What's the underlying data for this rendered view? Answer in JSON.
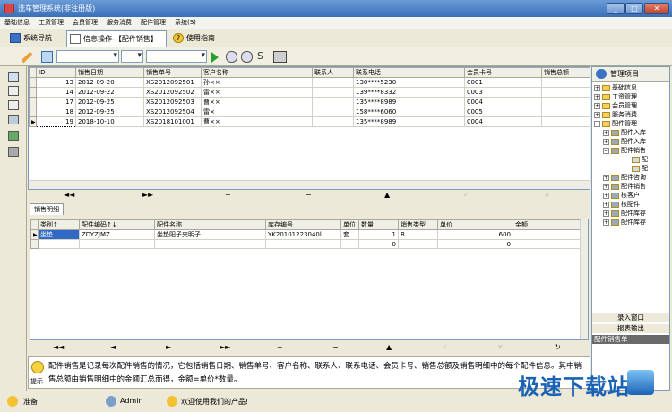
{
  "window": {
    "title": "洗车管理系统(非注册版)"
  },
  "menu": [
    "基础信息",
    "工资管理",
    "会员管理",
    "服务消费",
    "配件管理",
    "系统(S)"
  ],
  "tabs": [
    {
      "label": "系统导航"
    },
    {
      "label": "信息操作-【配件销售】"
    },
    {
      "label": "使用指南"
    }
  ],
  "sales_grid": {
    "columns": [
      "ID",
      "销售日期",
      "销售单号",
      "客户名称",
      "联系人",
      "联系电话",
      "会员卡号",
      "销售总额"
    ],
    "rows": [
      [
        "13",
        "2012-09-20",
        "XS2012092501",
        "孙××",
        "",
        "130****5230",
        "0001",
        ""
      ],
      [
        "14",
        "2012-09-22",
        "XS2012092502",
        "雷××",
        "",
        "139****8332",
        "0003",
        ""
      ],
      [
        "17",
        "2012-09-25",
        "XS2012092503",
        "曹××",
        "",
        "135****8989",
        "0004",
        ""
      ],
      [
        "18",
        "2012-09-25",
        "XS2012092504",
        "雷×",
        "",
        "158****6060",
        "0005",
        ""
      ],
      [
        "19",
        "2018-10-10",
        "XS2018101001",
        "曹××",
        "",
        "135****8989",
        "0004",
        ""
      ]
    ]
  },
  "nav_symbols": [
    "◄◄",
    "►►",
    "+",
    "−",
    "▲",
    "✓",
    "✕"
  ],
  "detail_tab": "销售明细",
  "detail_grid": {
    "columns": [
      "类别↑",
      "配件编码↑↓",
      "配件名称",
      "库存编号",
      "单位",
      "数量",
      "销售类型",
      "单价",
      "金额"
    ],
    "rows": [
      [
        "坐垫",
        "ZDYZJMZ",
        "坐垫阳子夹明子",
        "YK20101223040l",
        "套",
        "1",
        "B",
        "600",
        ""
      ],
      [
        "",
        "",
        "",
        "",
        "",
        "0",
        "",
        "0",
        ""
      ]
    ]
  },
  "nav2_symbols": [
    "◄◄",
    "◄",
    "►",
    "►►",
    "+",
    "−",
    "▲",
    "✓",
    "✕",
    "↻"
  ],
  "tip": {
    "label": "提示",
    "text": "配件销售是记录每次配件销售的情况，它包括销售日期、销售单号、客户名称、联系人、联系电话、会员卡号、销售总额及销售明细中的每个配件信息。其中销售总额由销售明细中的金额汇总而得，金额=单价*数量。"
  },
  "tree": {
    "title": "管理项目",
    "items": [
      "基础信息",
      "工资管理",
      "会员管理",
      "服务消费",
      "配件管理",
      "配件入库",
      "配件入库",
      "配件销售",
      "配",
      "配",
      "配件咨询",
      "配件销售",
      "核客户",
      "核配件",
      "配件库存",
      "配件库存"
    ],
    "buttons": [
      "录入窗口",
      "报表输出",
      "配件销售单"
    ]
  },
  "status": {
    "ready": "准备",
    "user": "Admin",
    "welcome": "欢迎使用我们的产品!"
  },
  "watermark": "极速下载站"
}
